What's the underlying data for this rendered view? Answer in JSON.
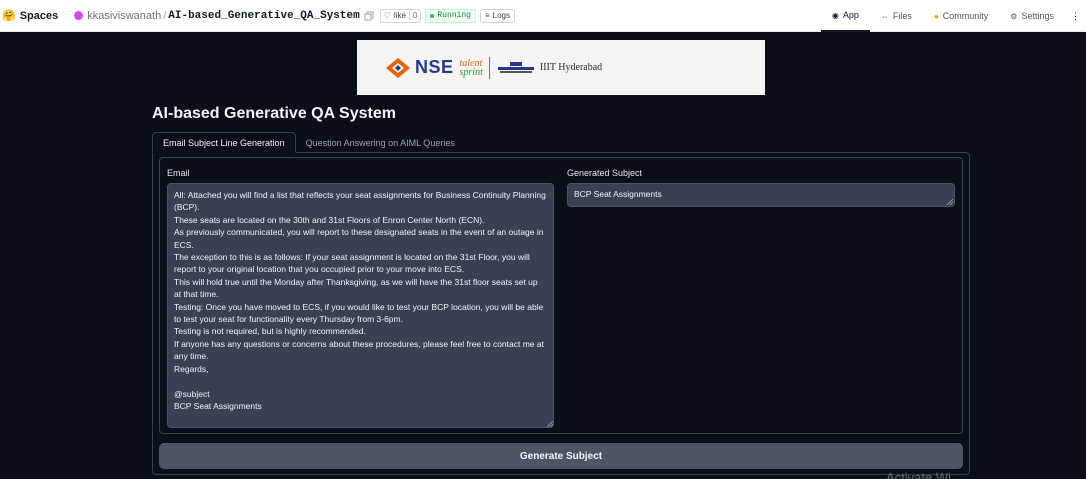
{
  "header": {
    "spaces_label": "Spaces",
    "owner": "kkasiviswanath",
    "separator": "/",
    "repo": "AI-based_Generative_QA_System",
    "like_label": "like",
    "like_count": "0",
    "status": "Running",
    "logs_label": "Logs",
    "nav": [
      {
        "label": "App",
        "icon": "app-icon"
      },
      {
        "label": "Files",
        "icon": "files-icon"
      },
      {
        "label": "Community",
        "icon": "community-icon"
      },
      {
        "label": "Settings",
        "icon": "gear-icon"
      }
    ],
    "more_label": "⋮"
  },
  "banner": {
    "nse": "NSE",
    "talent": "talent",
    "sprint": "sprint",
    "iiit": "IIIT Hyderabad"
  },
  "main": {
    "title": "AI-based Generative QA System",
    "tabs": [
      {
        "label": "Email Subject Line Generation",
        "active": true
      },
      {
        "label": "Question Answering on AIML Queries",
        "active": false
      }
    ],
    "email_label": "Email",
    "email_value": "All: Attached you will find a list that reflects your seat assignments for Business Continuity Planning (BCP).\nThese seats are located on the 30th and 31st Floors of Enron Center North (ECN).\nAs previously communicated, you will report to these designated seats in the event of an outage in ECS.\nThe exception to this is as follows: If your seat assignment is located on the 31st Floor, you will report to your original location that you occupied prior to your move into ECS.\nThis will hold true until the Monday after Thanksgiving, as we will have the 31st floor seats set up at that time.\nTesting: Once you have moved to ECS, if you would like to test your BCP location, you will be able to test your seat for functionality every Thursday from 3-6pm.\nTesting is not required, but is highly recommended.\nIf anyone has any questions or concerns about these procedures, please feel free to contact me at any time.\nRegards,\n\n@subject\nBCP Seat Assignments",
    "subject_label": "Generated Subject",
    "subject_value": "BCP Seat Assignments",
    "button_label": "Generate Subject"
  },
  "overlay": {
    "watermark": "Activate Wi"
  },
  "colors": {
    "background": "#0b0f19",
    "textarea": "#374151",
    "button": "#4b5563",
    "running": "#22c55e"
  }
}
